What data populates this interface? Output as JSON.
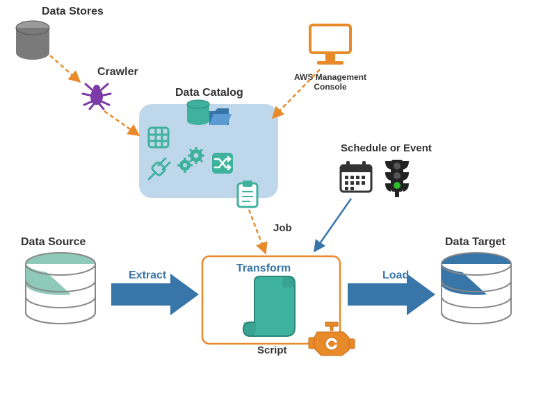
{
  "labels": {
    "data_stores": "Data Stores",
    "crawler": "Crawler",
    "data_catalog": "Data Catalog",
    "aws_console": "AWS Management Console",
    "schedule_event": "Schedule or Event",
    "job": "Job",
    "data_source": "Data Source",
    "data_target": "Data Target",
    "extract": "Extract",
    "transform": "Transform",
    "load": "Load",
    "script": "Script"
  },
  "colors": {
    "blue": "#3875a8",
    "teal": "#3fb29e",
    "orange": "#e88a2a",
    "purple": "#7b3aa7",
    "gray": "#7a7a7a",
    "panel": "#bfd7ea",
    "green": "#2bbd2b"
  }
}
